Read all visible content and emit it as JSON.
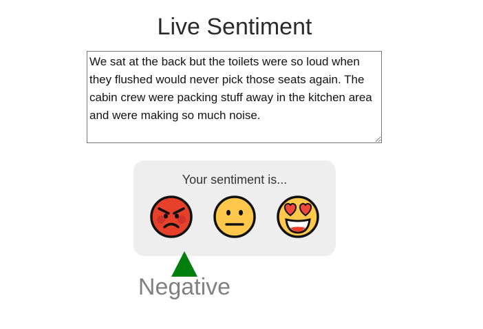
{
  "page": {
    "title": "Live Sentiment"
  },
  "input": {
    "text": "We sat at the back but the toilets were so loud when they flushed would never pick those seats again. The cabin crew were packing stuff away in the kitchen area and were making so much noise."
  },
  "sentiment_panel": {
    "label": "Your sentiment is...",
    "options": [
      {
        "icon": "angry-face-icon",
        "meaning": "negative",
        "color": "#e8412b"
      },
      {
        "icon": "neutral-face-icon",
        "meaning": "neutral",
        "color": "#ffc84a"
      },
      {
        "icon": "heart-eyes-face-icon",
        "meaning": "positive",
        "color": "#ffc84a"
      }
    ]
  },
  "result": {
    "label": "Negative",
    "indicator_color": "#007f0e"
  }
}
